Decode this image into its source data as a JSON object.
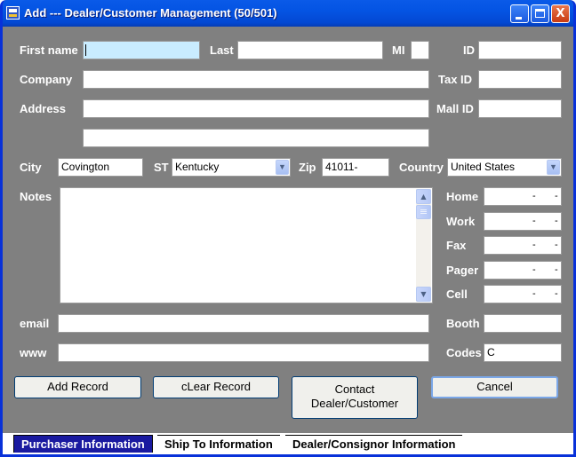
{
  "window": {
    "title": "Add --- Dealer/Customer Management (50/501)",
    "controls": {
      "minimize": "_",
      "maximize": "□",
      "close": "X"
    }
  },
  "labels": {
    "first_name": "First name",
    "last": "Last",
    "mi": "MI",
    "id": "ID",
    "company": "Company",
    "tax_id": "Tax ID",
    "address": "Address",
    "mall_id": "Mall ID",
    "city": "City",
    "st": "ST",
    "zip": "Zip",
    "country": "Country",
    "notes": "Notes",
    "home": "Home",
    "work": "Work",
    "fax": "Fax",
    "pager": "Pager",
    "cell": "Cell",
    "email": "email",
    "www": "www",
    "booth": "Booth",
    "codes": "Codes"
  },
  "values": {
    "first_name": "",
    "last": "",
    "mi": "",
    "id": "",
    "company": "",
    "tax_id": "",
    "address1": "",
    "address2": "",
    "mall_id": "",
    "city": "Covington",
    "st": "Kentucky",
    "zip": "41011-",
    "country": "United States",
    "notes": "",
    "email": "",
    "www": "",
    "booth": "",
    "codes": "C",
    "phone_separator": "-"
  },
  "buttons": {
    "add_record": "Add Record",
    "clear_record": "cLear Record",
    "contact_line1": "Contact",
    "contact_line2": "Dealer/Customer",
    "cancel": "Cancel"
  },
  "tabs": [
    {
      "label": "Purchaser Information",
      "selected": true
    },
    {
      "label": "Ship To Information",
      "selected": false
    },
    {
      "label": "Dealer/Consignor Information",
      "selected": false
    }
  ],
  "colors": {
    "form_background": "#808080",
    "titlebar": "#0454e3",
    "active_field": "#c9ecff",
    "selected_tab": "#1a1aa0"
  }
}
